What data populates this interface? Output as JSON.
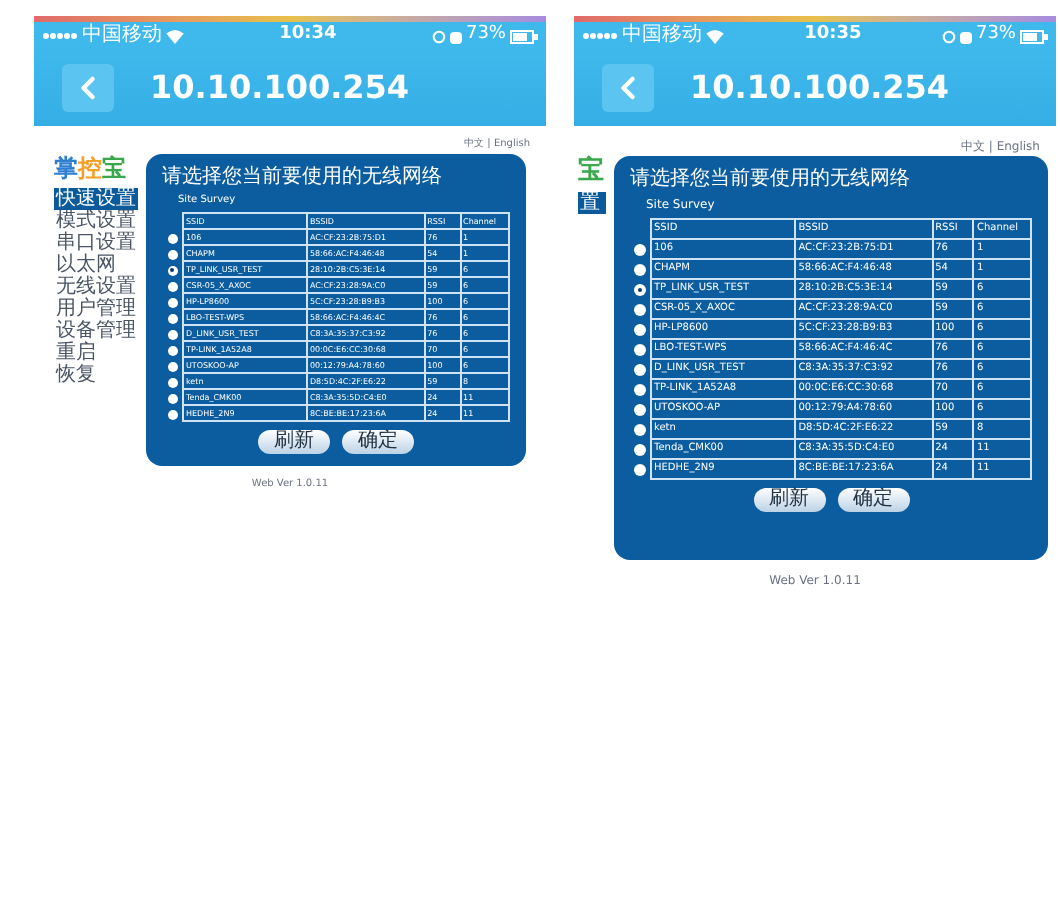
{
  "screens": [
    {
      "status": {
        "carrier": "中国移动",
        "time": "10:34",
        "battery": "73%"
      },
      "nav": {
        "title": "10.10.100.254"
      },
      "page": {
        "lang_links": "中文 | English",
        "logo": [
          {
            "char": "掌",
            "color": "#2e7fd0"
          },
          {
            "char": "控",
            "color": "#f2a02a"
          },
          {
            "char": "宝",
            "color": "#3aa84a"
          }
        ],
        "sidebar": [
          {
            "label": "快速设置",
            "selected": true
          },
          {
            "label": "模式设置",
            "selected": false
          },
          {
            "label": "串口设置",
            "selected": false
          },
          {
            "label": "以太网",
            "selected": false
          },
          {
            "label": "无线设置",
            "selected": false
          },
          {
            "label": "用户管理",
            "selected": false
          },
          {
            "label": "设备管理",
            "selected": false
          },
          {
            "label": "重启",
            "selected": false
          },
          {
            "label": "恢复",
            "selected": false
          }
        ],
        "dialog": {
          "title": "请选择您当前要使用的无线网络",
          "subtitle": "Site Survey",
          "columns": [
            "SSID",
            "BSSID",
            "RSSI",
            "Channel"
          ],
          "rows": [
            {
              "cells": [
                "106",
                "AC:CF:23:2B:75:D1",
                "76",
                "1"
              ],
              "selected": false
            },
            {
              "cells": [
                "CHAPM",
                "58:66:AC:F4:46:48",
                "54",
                "1"
              ],
              "selected": false
            },
            {
              "cells": [
                "TP_LINK_USR_TEST",
                "28:10:2B:C5:3E:14",
                "59",
                "6"
              ],
              "selected": true
            },
            {
              "cells": [
                "CSR-05_X_AXOC",
                "AC:CF:23:28:9A:C0",
                "59",
                "6"
              ],
              "selected": false
            },
            {
              "cells": [
                "HP-LP8600",
                "5C:CF:23:28:B9:B3",
                "100",
                "6"
              ],
              "selected": false
            },
            {
              "cells": [
                "LBO-TEST-WPS",
                "58:66:AC:F4:46:4C",
                "76",
                "6"
              ],
              "selected": false
            },
            {
              "cells": [
                "D_LINK_USR_TEST",
                "C8:3A:35:37:C3:92",
                "76",
                "6"
              ],
              "selected": false
            },
            {
              "cells": [
                "TP-LINK_1A52A8",
                "00:0C:E6:CC:30:68",
                "70",
                "6"
              ],
              "selected": false
            },
            {
              "cells": [
                "UTOSKOO-AP",
                "00:12:79:A4:78:60",
                "100",
                "6"
              ],
              "selected": false
            },
            {
              "cells": [
                "ketn",
                "D8:5D:4C:2F:E6:22",
                "59",
                "8"
              ],
              "selected": false
            },
            {
              "cells": [
                "Tenda_CMK00",
                "C8:3A:35:5D:C4:E0",
                "24",
                "11"
              ],
              "selected": false
            },
            {
              "cells": [
                "HEDHE_2N9",
                "8C:BE:BE:17:23:6A",
                "24",
                "11"
              ],
              "selected": false
            }
          ],
          "buttons": [
            "刷新",
            "确定"
          ]
        },
        "footer": "Web Ver 1.0.11"
      }
    },
    {
      "status": {
        "carrier": "中国移动",
        "time": "10:35",
        "battery": "73%"
      },
      "nav": {
        "title": "10.10.100.254"
      },
      "page": {
        "lang_links": "中文 | English",
        "logo": [
          {
            "char": "宝",
            "color": "#3aa84a"
          }
        ],
        "sidebar": [
          {
            "label": "置",
            "selected": true
          }
        ],
        "dialog": {
          "title": "请选择您当前要使用的无线网络",
          "subtitle": "Site Survey",
          "columns": [
            "SSID",
            "BSSID",
            "RSSI",
            "Channel"
          ],
          "rows": [
            {
              "cells": [
                "106",
                "AC:CF:23:2B:75:D1",
                "76",
                "1"
              ],
              "selected": false
            },
            {
              "cells": [
                "CHAPM",
                "58:66:AC:F4:46:48",
                "54",
                "1"
              ],
              "selected": false
            },
            {
              "cells": [
                "TP_LINK_USR_TEST",
                "28:10:2B:C5:3E:14",
                "59",
                "6"
              ],
              "selected": true
            },
            {
              "cells": [
                "CSR-05_X_AXOC",
                "AC:CF:23:28:9A:C0",
                "59",
                "6"
              ],
              "selected": false
            },
            {
              "cells": [
                "HP-LP8600",
                "5C:CF:23:28:B9:B3",
                "100",
                "6"
              ],
              "selected": false
            },
            {
              "cells": [
                "LBO-TEST-WPS",
                "58:66:AC:F4:46:4C",
                "76",
                "6"
              ],
              "selected": false
            },
            {
              "cells": [
                "D_LINK_USR_TEST",
                "C8:3A:35:37:C3:92",
                "76",
                "6"
              ],
              "selected": false
            },
            {
              "cells": [
                "TP-LINK_1A52A8",
                "00:0C:E6:CC:30:68",
                "70",
                "6"
              ],
              "selected": false
            },
            {
              "cells": [
                "UTOSKOO-AP",
                "00:12:79:A4:78:60",
                "100",
                "6"
              ],
              "selected": false
            },
            {
              "cells": [
                "ketn",
                "D8:5D:4C:2F:E6:22",
                "59",
                "8"
              ],
              "selected": false
            },
            {
              "cells": [
                "Tenda_CMK00",
                "C8:3A:35:5D:C4:E0",
                "24",
                "11"
              ],
              "selected": false
            },
            {
              "cells": [
                "HEDHE_2N9",
                "8C:BE:BE:17:23:6A",
                "24",
                "11"
              ],
              "selected": false
            }
          ],
          "buttons": [
            "刷新",
            "确定"
          ]
        },
        "footer": "Web Ver 1.0.11"
      }
    }
  ]
}
